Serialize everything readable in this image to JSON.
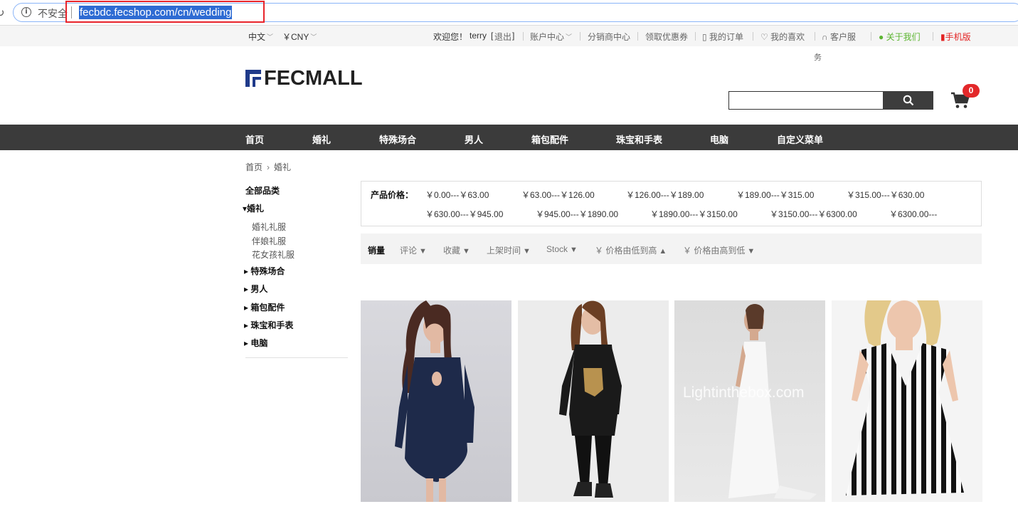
{
  "browser": {
    "insecure_label": "不安全",
    "url": "fecbdc.fecshop.com/cn/wedding"
  },
  "topbar": {
    "language": "中文",
    "currency": "￥CNY",
    "welcome": "欢迎您！",
    "username": "terry",
    "logout_prefix": "[",
    "logout": "退出",
    "logout_suffix": "]",
    "account": "账户中心",
    "distributor": "分销商中心",
    "coupons": "领取优惠券",
    "orders": "我的订单",
    "favorites": "我的喜欢",
    "service": "客户服",
    "service_wrap": "务",
    "about": "关于我们",
    "mobile": "手机版"
  },
  "header": {
    "logo_text": "FECMALL",
    "cart_count": "0"
  },
  "nav": {
    "items": [
      "首页",
      "婚礼",
      "特殊场合",
      "男人",
      "箱包配件",
      "珠宝和手表",
      "电脑",
      "自定义菜单"
    ]
  },
  "breadcrumb": {
    "home": "首页",
    "arrow": "›",
    "current": "婚礼"
  },
  "sidebar": {
    "all_categories": "全部品类",
    "current_category": "婚礼",
    "subcategories": [
      "婚礼礼服",
      "伴娘礼服",
      "花女孩礼服"
    ],
    "categories": [
      "特殊场合",
      "男人",
      "箱包配件",
      "珠宝和手表",
      "电脑"
    ]
  },
  "price_filter": {
    "label": "产品价格：",
    "row1": [
      "￥0.00---￥63.00",
      "￥63.00---￥126.00",
      "￥126.00---￥189.00",
      "￥189.00---￥315.00",
      "￥315.00---￥630.00"
    ],
    "row2": [
      "￥630.00---￥945.00",
      "￥945.00---￥1890.00",
      "￥1890.00---￥3150.00",
      "￥3150.00---￥6300.00",
      "￥6300.00---"
    ]
  },
  "sort": {
    "items": [
      "销量",
      "评论",
      "收藏",
      "上架时间",
      "Stock",
      "￥ 价格由低到高",
      "￥ 价格由高到低"
    ]
  },
  "products": {
    "watermark": "Lightinthebox.com"
  }
}
